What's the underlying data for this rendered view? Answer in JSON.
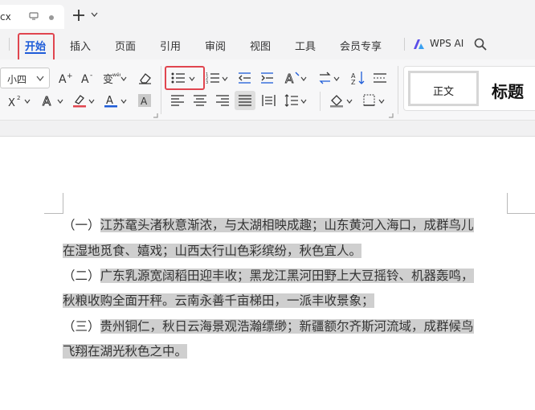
{
  "titlebar": {
    "doc_tab_name": "cx",
    "new_tab_icon": "plus-icon"
  },
  "menu": {
    "tabs": [
      "开始",
      "插入",
      "页面",
      "引用",
      "审阅",
      "视图",
      "工具",
      "会员专享"
    ],
    "active": "开始",
    "wps_ai": "WPS AI"
  },
  "ribbon": {
    "font_size": "小四",
    "styles": {
      "normal": "正文",
      "title": "标题"
    },
    "icons": [
      "grow-font-icon",
      "shrink-font-icon",
      "phonetic-guide-icon",
      "clear-format-icon",
      "bullet-list-icon",
      "numbered-list-icon",
      "decrease-indent-icon",
      "increase-indent-icon",
      "text-effects-icon",
      "text-direction-icon",
      "sort-icon",
      "show-marks-icon",
      "superscript-icon",
      "text-outline-icon",
      "highlight-icon",
      "font-color-icon",
      "char-shading-icon",
      "align-left-icon",
      "align-center-icon",
      "align-right-icon",
      "justify-icon",
      "distribute-icon",
      "line-spacing-icon",
      "shading-icon",
      "borders-icon"
    ],
    "font_color": "#1d5bd8",
    "highlight_color": "#e0454f"
  },
  "document": {
    "paragraphs": [
      {
        "lines": [
          "（一）江苏鼋头渚秋意渐浓，与太湖相映成趣；山东黄河入海口，成群鸟儿",
          "在湿地觅食、嬉戏；山西太行山色彩缤纷，秋色宜人。"
        ]
      },
      {
        "lines": [
          "（二）广东乳源宽阔稻田迎丰收；黑龙江黑河田野上大豆摇铃、机器轰鸣，",
          "秋粮收购全面开秤。云南永善千亩梯田，一派丰收景象；"
        ]
      },
      {
        "lines": [
          "（三）贵州铜仁，秋日云海景观浩瀚缥缈；新疆额尔齐斯河流域，成群候鸟",
          "飞翔在湖光秋色之中。"
        ]
      }
    ],
    "selection_color": "#cfcfcf"
  },
  "highlighted_controls": [
    "开始",
    "bullet-list-icon"
  ]
}
